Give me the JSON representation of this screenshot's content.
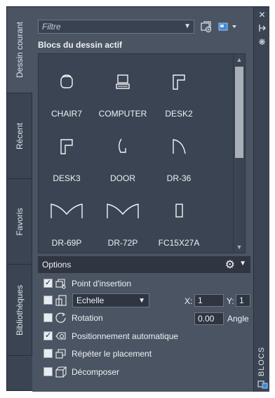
{
  "tabs": {
    "current": "Dessin courant",
    "recent": "Récent",
    "favorites": "Favoris",
    "libraries": "Bibliothèques"
  },
  "palette_title": "BLOCS",
  "filter": {
    "placeholder": "Filtre"
  },
  "section_title": "Blocs du dessin actif",
  "blocks": [
    {
      "name": "CHAIR7",
      "icon": "chair-icon"
    },
    {
      "name": "COMPUTER",
      "icon": "computer-icon"
    },
    {
      "name": "DESK2",
      "icon": "desk2-icon"
    },
    {
      "name": "DESK3",
      "icon": "desk3-icon"
    },
    {
      "name": "DOOR",
      "icon": "door-icon"
    },
    {
      "name": "DR-36",
      "icon": "dr36-icon"
    },
    {
      "name": "DR-69P",
      "icon": "dr69p-icon"
    },
    {
      "name": "DR-72P",
      "icon": "dr72p-icon"
    },
    {
      "name": "FC15X27A",
      "icon": "fc15x27a-icon"
    }
  ],
  "options": {
    "title": "Options",
    "insertion_point": {
      "label": "Point d'insertion",
      "checked": true
    },
    "scale": {
      "checked": false,
      "selected": "Echelle",
      "x_label": "X:",
      "x_value": "1",
      "y_label": "Y:",
      "y_value": "1"
    },
    "rotation": {
      "label": "Rotation",
      "checked": false,
      "value": "0.00",
      "angle_label": "Angle"
    },
    "auto_placement": {
      "label": "Positionnement automatique",
      "checked": true
    },
    "repeat_placement": {
      "label": "Répéter le placement",
      "checked": false
    },
    "explode": {
      "label": "Décomposer",
      "checked": false
    }
  },
  "colors": {
    "panel_bg": "#4a5463",
    "dark_bg": "#3b4453",
    "accent_blue": "#3d8bd6"
  }
}
